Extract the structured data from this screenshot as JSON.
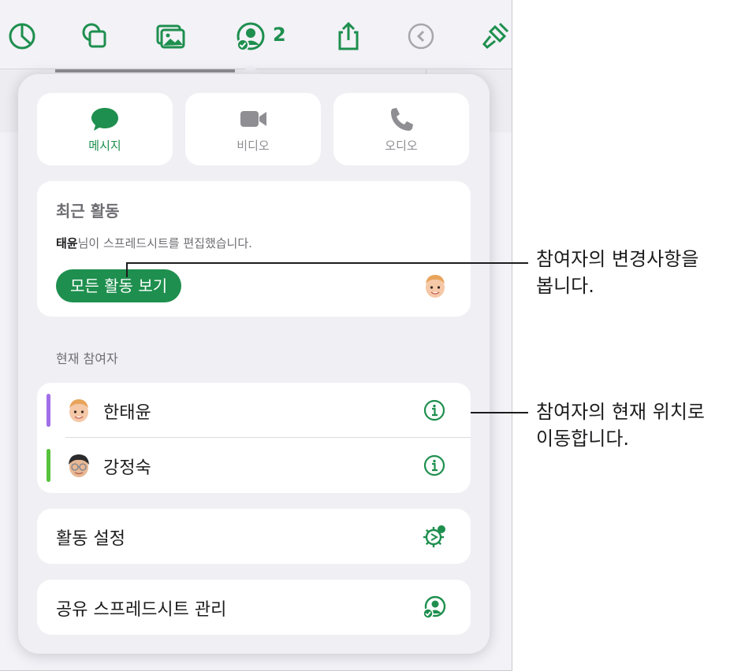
{
  "toolbar": {
    "items": [
      {
        "icon": "pie-chart-icon"
      },
      {
        "icon": "shapes-icon"
      },
      {
        "icon": "media-icon"
      },
      {
        "icon": "collaboration-icon"
      },
      {
        "icon": "share-icon"
      },
      {
        "icon": "undo-icon"
      },
      {
        "icon": "format-brush-icon"
      }
    ],
    "collaborator_count": "2"
  },
  "popover": {
    "call_buttons": [
      {
        "label": "메시지",
        "icon": "message-bubble-icon",
        "active": true
      },
      {
        "label": "비디오",
        "icon": "video-camera-icon",
        "active": false
      },
      {
        "label": "오디오",
        "icon": "phone-icon",
        "active": false
      }
    ],
    "recent_activity": {
      "title": "최근 활동",
      "user": "태윤",
      "text": "님이 스프레드시트를 편집했습니다.",
      "button_label": "모든 활동 보기"
    },
    "participants_label": "현재 참여자",
    "participants": [
      {
        "name": "한태윤",
        "color": "#a06ee8"
      },
      {
        "name": "강정숙",
        "color": "#57c23c"
      }
    ],
    "activity_settings_label": "활동 설정",
    "manage_label": "공유 스프레드시트 관리"
  },
  "callouts": {
    "first": [
      "참여자의 변경사항을",
      "봅니다."
    ],
    "second": [
      "참여자의 현재 위치로",
      "이동합니다."
    ]
  },
  "colors": {
    "accent": "#1e8f4e",
    "inactive": "#8e8e93",
    "background": "#efeff4"
  }
}
